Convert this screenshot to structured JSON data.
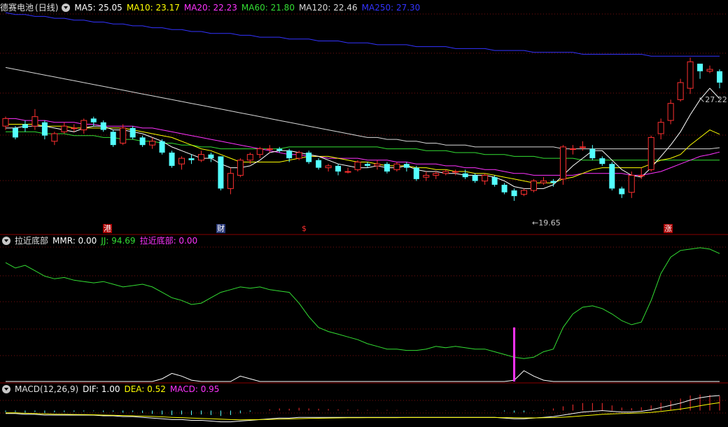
{
  "panel1": {
    "stock_name": "德赛电池",
    "period": "(日线)",
    "ma_labels": [
      {
        "label": "MA5: 25.05",
        "color": "#ffffff"
      },
      {
        "label": "MA10: 23.17",
        "color": "#ffff00"
      },
      {
        "label": "MA20: 22.23",
        "color": "#ff33ff"
      },
      {
        "label": "MA60: 21.80",
        "color": "#33dd33"
      },
      {
        "label": "MA120: 22.46",
        "color": "#d8d8d8"
      },
      {
        "label": "MA250: 27.30",
        "color": "#3333ff"
      }
    ],
    "high_label": "27.22",
    "low_label": "19.65",
    "markers": [
      "港",
      "财",
      "$",
      "涨"
    ]
  },
  "panel2": {
    "title": "拉近底部",
    "values": [
      {
        "label": "MMR: 0.00",
        "color": "#ffffff"
      },
      {
        "label": "JJ: 94.69",
        "color": "#33dd33"
      },
      {
        "label": "拉近底部: 0.00",
        "color": "#ff33ff"
      }
    ]
  },
  "panel3": {
    "title": "MACD(12,26,9)",
    "values": [
      {
        "label": "DIF: 1.00",
        "color": "#ffffff"
      },
      {
        "label": "DEA: 0.52",
        "color": "#ffff00"
      },
      {
        "label": "MACD: 0.95",
        "color": "#ff33ff"
      }
    ]
  },
  "chart_data": {
    "type": "candlestick",
    "price_range": [
      18.5,
      29.6
    ],
    "candles": [
      [
        23.6,
        24.0,
        24.1,
        23.4
      ],
      [
        23.5,
        23.0,
        23.6,
        22.9
      ],
      [
        23.7,
        23.5,
        23.9,
        23.3
      ],
      [
        23.6,
        24.1,
        24.5,
        23.4
      ],
      [
        23.8,
        23.1,
        23.9,
        22.9
      ],
      [
        22.8,
        23.2,
        23.3,
        22.6
      ],
      [
        23.3,
        23.6,
        23.8,
        23.2
      ],
      [
        23.5,
        23.5,
        23.7,
        23.3
      ],
      [
        23.4,
        23.9,
        24.0,
        23.2
      ],
      [
        24.0,
        23.8,
        24.1,
        23.6
      ],
      [
        23.8,
        23.4,
        23.9,
        23.3
      ],
      [
        23.3,
        22.6,
        23.4,
        22.5
      ],
      [
        22.7,
        23.5,
        23.7,
        22.6
      ],
      [
        23.5,
        23.0,
        23.6,
        22.9
      ],
      [
        23.0,
        22.6,
        23.1,
        22.5
      ],
      [
        22.6,
        22.8,
        23.0,
        22.4
      ],
      [
        22.8,
        22.2,
        22.9,
        22.1
      ],
      [
        22.2,
        21.5,
        22.3,
        21.4
      ],
      [
        21.6,
        21.9,
        22.0,
        21.3
      ],
      [
        21.9,
        21.8,
        22.1,
        21.6
      ],
      [
        21.8,
        22.1,
        22.3,
        21.7
      ],
      [
        22.1,
        21.9,
        22.2,
        21.7
      ],
      [
        22.0,
        20.3,
        22.0,
        20.2
      ],
      [
        20.3,
        21.1,
        21.4,
        20.0
      ],
      [
        21.0,
        21.8,
        21.9,
        20.9
      ],
      [
        21.8,
        22.1,
        22.2,
        21.6
      ],
      [
        22.1,
        22.4,
        22.5,
        21.9
      ],
      [
        22.4,
        22.4,
        22.6,
        22.2
      ],
      [
        22.4,
        22.3,
        22.5,
        22.2
      ],
      [
        22.3,
        21.9,
        22.4,
        21.7
      ],
      [
        21.9,
        22.2,
        22.3,
        21.8
      ],
      [
        22.2,
        21.7,
        22.3,
        21.6
      ],
      [
        21.8,
        21.4,
        21.9,
        21.3
      ],
      [
        21.4,
        21.5,
        21.6,
        21.2
      ],
      [
        21.5,
        21.2,
        21.6,
        21.0
      ],
      [
        21.2,
        21.2,
        21.4,
        21.1
      ],
      [
        21.3,
        21.7,
        21.8,
        21.2
      ],
      [
        21.6,
        21.5,
        21.7,
        21.4
      ],
      [
        21.5,
        21.6,
        21.8,
        21.3
      ],
      [
        21.6,
        21.2,
        21.7,
        21.1
      ],
      [
        21.3,
        21.6,
        21.7,
        21.2
      ],
      [
        21.6,
        21.4,
        21.7,
        21.2
      ],
      [
        21.4,
        20.8,
        21.5,
        20.7
      ],
      [
        20.9,
        21.0,
        21.2,
        20.7
      ],
      [
        21.0,
        21.1,
        21.2,
        20.8
      ],
      [
        21.1,
        21.2,
        21.3,
        21.0
      ],
      [
        21.2,
        21.2,
        21.3,
        21.0
      ],
      [
        21.1,
        20.9,
        21.3,
        20.8
      ],
      [
        21.0,
        20.7,
        21.1,
        20.6
      ],
      [
        20.7,
        21.0,
        21.1,
        20.5
      ],
      [
        20.9,
        20.5,
        21.0,
        20.4
      ],
      [
        20.5,
        20.1,
        20.6,
        20.0
      ],
      [
        20.2,
        19.9,
        20.3,
        19.65
      ],
      [
        20.0,
        20.2,
        20.3,
        19.9
      ],
      [
        20.2,
        20.7,
        20.8,
        20.1
      ],
      [
        20.6,
        20.7,
        20.9,
        20.5
      ],
      [
        20.7,
        20.6,
        20.8,
        20.4
      ],
      [
        20.8,
        22.5,
        22.6,
        20.5
      ],
      [
        22.4,
        22.4,
        22.6,
        22.1
      ],
      [
        22.5,
        22.5,
        22.8,
        22.3
      ],
      [
        22.4,
        21.9,
        22.6,
        21.8
      ],
      [
        21.9,
        21.6,
        22.0,
        21.5
      ],
      [
        21.6,
        20.3,
        21.7,
        20.2
      ],
      [
        20.3,
        20.0,
        20.4,
        19.8
      ],
      [
        20.1,
        21.0,
        21.2,
        19.8
      ],
      [
        21.0,
        21.0,
        21.4,
        20.8
      ],
      [
        21.3,
        23.0,
        23.1,
        21.2
      ],
      [
        23.2,
        23.8,
        24.0,
        22.9
      ],
      [
        23.9,
        24.8,
        25.0,
        23.7
      ],
      [
        25.0,
        25.9,
        26.1,
        24.9
      ],
      [
        25.6,
        27.0,
        27.22,
        25.3
      ],
      [
        26.9,
        26.5,
        26.9,
        26.1
      ],
      [
        26.5,
        26.6,
        26.8,
        26.4
      ],
      [
        26.5,
        25.9,
        26.6,
        25.6
      ]
    ],
    "ma_series": {
      "MA5": [
        23.5,
        23.5,
        23.6,
        23.6,
        23.6,
        23.5,
        23.4,
        23.3,
        23.5,
        23.6,
        23.6,
        23.4,
        23.4,
        23.3,
        23.2,
        23.0,
        22.8,
        22.5,
        22.3,
        22.1,
        21.9,
        21.9,
        21.6,
        21.4,
        21.4,
        21.5,
        21.8,
        22.2,
        22.3,
        22.3,
        22.2,
        22.1,
        22.0,
        21.8,
        21.6,
        21.5,
        21.4,
        21.4,
        21.5,
        21.4,
        21.4,
        21.5,
        21.3,
        21.2,
        21.2,
        21.1,
        21.1,
        21.0,
        21.0,
        21.0,
        20.9,
        20.7,
        20.4,
        20.3,
        20.3,
        20.3,
        20.5,
        21.0,
        21.5,
        21.9,
        22.3,
        22.3,
        21.8,
        21.3,
        21.0,
        20.9,
        21.4,
        22.0,
        22.6,
        23.3,
        24.2,
        25.0,
        25.6,
        25.05
      ],
      "MA10": [
        23.7,
        23.7,
        23.7,
        23.7,
        23.6,
        23.6,
        23.6,
        23.5,
        23.5,
        23.5,
        23.5,
        23.5,
        23.5,
        23.4,
        23.3,
        23.2,
        23.1,
        23.0,
        22.8,
        22.6,
        22.4,
        22.3,
        22.1,
        21.9,
        21.7,
        21.7,
        21.7,
        21.7,
        21.7,
        21.8,
        21.9,
        22.0,
        22.0,
        22.0,
        21.9,
        21.8,
        21.7,
        21.7,
        21.6,
        21.5,
        21.5,
        21.5,
        21.4,
        21.4,
        21.3,
        21.3,
        21.2,
        21.2,
        21.1,
        21.1,
        21.0,
        20.9,
        20.8,
        20.7,
        20.6,
        20.6,
        20.6,
        20.8,
        20.9,
        21.1,
        21.3,
        21.4,
        21.4,
        21.4,
        21.4,
        21.4,
        21.6,
        21.8,
        21.9,
        22.1,
        22.6,
        23.0,
        23.4,
        23.17
      ],
      "MA20": [
        24.0,
        24.0,
        23.9,
        23.9,
        23.9,
        23.8,
        23.8,
        23.8,
        23.7,
        23.7,
        23.6,
        23.6,
        23.6,
        23.6,
        23.5,
        23.5,
        23.4,
        23.3,
        23.2,
        23.1,
        23.0,
        22.9,
        22.8,
        22.7,
        22.6,
        22.5,
        22.4,
        22.3,
        22.2,
        22.1,
        22.1,
        22.0,
        22.0,
        21.9,
        21.9,
        21.9,
        21.9,
        21.8,
        21.8,
        21.8,
        21.7,
        21.7,
        21.6,
        21.6,
        21.6,
        21.5,
        21.5,
        21.4,
        21.4,
        21.3,
        21.3,
        21.2,
        21.1,
        21.1,
        21.0,
        21.0,
        21.0,
        21.0,
        21.0,
        21.1,
        21.1,
        21.1,
        21.1,
        21.1,
        21.0,
        21.0,
        21.1,
        21.2,
        21.4,
        21.6,
        21.8,
        22.0,
        22.1,
        22.23
      ],
      "MA60": [
        23.3,
        23.3,
        23.3,
        23.3,
        23.2,
        23.2,
        23.2,
        23.1,
        23.1,
        23.1,
        23.0,
        23.0,
        22.9,
        22.9,
        22.8,
        22.8,
        22.7,
        22.7,
        22.6,
        22.6,
        22.5,
        22.5,
        22.4,
        22.4,
        22.4,
        22.4,
        22.4,
        22.4,
        22.4,
        22.5,
        22.5,
        22.5,
        22.5,
        22.5,
        22.5,
        22.5,
        22.5,
        22.5,
        22.5,
        22.4,
        22.4,
        22.4,
        22.4,
        22.3,
        22.3,
        22.3,
        22.2,
        22.2,
        22.2,
        22.1,
        22.1,
        22.1,
        22.0,
        22.0,
        22.0,
        21.9,
        21.9,
        21.9,
        21.9,
        21.8,
        21.8,
        21.8,
        21.8,
        21.8,
        21.8,
        21.8,
        21.8,
        21.8,
        21.8,
        21.8,
        21.8,
        21.8,
        21.8,
        21.8
      ],
      "MA120": [
        26.7,
        26.6,
        26.5,
        26.4,
        26.3,
        26.2,
        26.1,
        26.0,
        25.9,
        25.8,
        25.7,
        25.6,
        25.5,
        25.4,
        25.3,
        25.2,
        25.1,
        25.0,
        24.9,
        24.8,
        24.7,
        24.6,
        24.5,
        24.4,
        24.3,
        24.2,
        24.1,
        24.0,
        23.9,
        23.8,
        23.7,
        23.6,
        23.5,
        23.4,
        23.3,
        23.2,
        23.1,
        23.0,
        23.0,
        22.9,
        22.9,
        22.8,
        22.8,
        22.7,
        22.7,
        22.6,
        22.6,
        22.6,
        22.5,
        22.5,
        22.5,
        22.5,
        22.5,
        22.5,
        22.5,
        22.5,
        22.5,
        22.4,
        22.4,
        22.4,
        22.4,
        22.4,
        22.4,
        22.4,
        22.4,
        22.4,
        22.4,
        22.4,
        22.4,
        22.4,
        22.4,
        22.4,
        22.4,
        22.46
      ],
      "MA250": [
        29.6,
        29.5,
        29.5,
        29.4,
        29.4,
        29.3,
        29.3,
        29.2,
        29.2,
        29.1,
        29.1,
        29.0,
        29.0,
        28.9,
        28.9,
        28.8,
        28.8,
        28.7,
        28.7,
        28.6,
        28.6,
        28.5,
        28.5,
        28.5,
        28.4,
        28.4,
        28.3,
        28.3,
        28.3,
        28.2,
        28.2,
        28.2,
        28.1,
        28.1,
        28.1,
        28.0,
        28.0,
        28.0,
        27.9,
        27.9,
        27.9,
        27.9,
        27.8,
        27.8,
        27.8,
        27.8,
        27.7,
        27.7,
        27.7,
        27.7,
        27.6,
        27.6,
        27.6,
        27.6,
        27.5,
        27.5,
        27.5,
        27.5,
        27.5,
        27.4,
        27.4,
        27.4,
        27.4,
        27.4,
        27.4,
        27.4,
        27.3,
        27.3,
        27.3,
        27.3,
        27.3,
        27.3,
        27.3,
        27.3
      ]
    },
    "jj": [
      88,
      84,
      86,
      82,
      78,
      76,
      77,
      75,
      74,
      73,
      74,
      72,
      70,
      71,
      72,
      70,
      66,
      62,
      60,
      57,
      58,
      62,
      66,
      68,
      70,
      69,
      70,
      68,
      67,
      66,
      58,
      48,
      40,
      37,
      35,
      33,
      31,
      28,
      26,
      24,
      24,
      23,
      23,
      24,
      26,
      25,
      26,
      25,
      24,
      24,
      22,
      20,
      18,
      17,
      18,
      22,
      24,
      40,
      50,
      55,
      56,
      54,
      50,
      45,
      42,
      44,
      60,
      80,
      92,
      97,
      98,
      99,
      98,
      94.69
    ],
    "mmr": [
      0,
      0,
      0,
      0,
      0,
      0,
      0,
      0,
      0,
      0,
      0,
      0,
      0,
      0,
      0,
      0,
      2,
      6,
      4,
      1,
      0,
      0,
      0,
      0,
      4,
      2,
      0,
      0,
      0,
      0,
      0,
      0,
      0,
      0,
      0,
      0,
      0,
      0,
      0,
      0,
      0,
      0,
      0,
      0,
      0,
      0,
      0,
      0,
      0,
      0,
      0,
      0,
      1,
      8,
      4,
      1,
      0,
      0,
      0,
      0,
      0,
      0,
      0,
      0,
      0,
      0,
      0,
      0,
      0,
      0,
      0,
      0,
      0,
      0
    ],
    "bottom_signal_index": 52,
    "macd": {
      "dif": [
        -0.2,
        -0.2,
        -0.25,
        -0.25,
        -0.3,
        -0.3,
        -0.3,
        -0.3,
        -0.3,
        -0.3,
        -0.35,
        -0.35,
        -0.4,
        -0.4,
        -0.45,
        -0.5,
        -0.55,
        -0.6,
        -0.6,
        -0.65,
        -0.65,
        -0.7,
        -0.75,
        -0.75,
        -0.7,
        -0.65,
        -0.6,
        -0.55,
        -0.5,
        -0.5,
        -0.45,
        -0.45,
        -0.45,
        -0.45,
        -0.45,
        -0.45,
        -0.45,
        -0.45,
        -0.45,
        -0.45,
        -0.45,
        -0.45,
        -0.45,
        -0.45,
        -0.45,
        -0.45,
        -0.45,
        -0.45,
        -0.45,
        -0.45,
        -0.45,
        -0.5,
        -0.55,
        -0.55,
        -0.5,
        -0.45,
        -0.4,
        -0.3,
        -0.2,
        -0.1,
        -0.05,
        0.0,
        -0.05,
        -0.1,
        -0.1,
        -0.05,
        0.05,
        0.2,
        0.35,
        0.5,
        0.7,
        0.85,
        0.95,
        1.0
      ],
      "dea": [
        -0.15,
        -0.15,
        -0.18,
        -0.2,
        -0.22,
        -0.24,
        -0.25,
        -0.26,
        -0.27,
        -0.28,
        -0.3,
        -0.31,
        -0.33,
        -0.35,
        -0.37,
        -0.39,
        -0.42,
        -0.45,
        -0.47,
        -0.5,
        -0.52,
        -0.55,
        -0.57,
        -0.6,
        -0.61,
        -0.61,
        -0.6,
        -0.59,
        -0.57,
        -0.56,
        -0.54,
        -0.52,
        -0.51,
        -0.5,
        -0.49,
        -0.48,
        -0.48,
        -0.47,
        -0.47,
        -0.47,
        -0.47,
        -0.46,
        -0.46,
        -0.46,
        -0.46,
        -0.46,
        -0.46,
        -0.46,
        -0.46,
        -0.46,
        -0.46,
        -0.47,
        -0.48,
        -0.49,
        -0.49,
        -0.48,
        -0.47,
        -0.44,
        -0.4,
        -0.35,
        -0.3,
        -0.25,
        -0.22,
        -0.2,
        -0.18,
        -0.16,
        -0.12,
        -0.06,
        0.02,
        0.1,
        0.2,
        0.32,
        0.43,
        0.52
      ],
      "range": [
        -1.0,
        1.0
      ]
    }
  }
}
